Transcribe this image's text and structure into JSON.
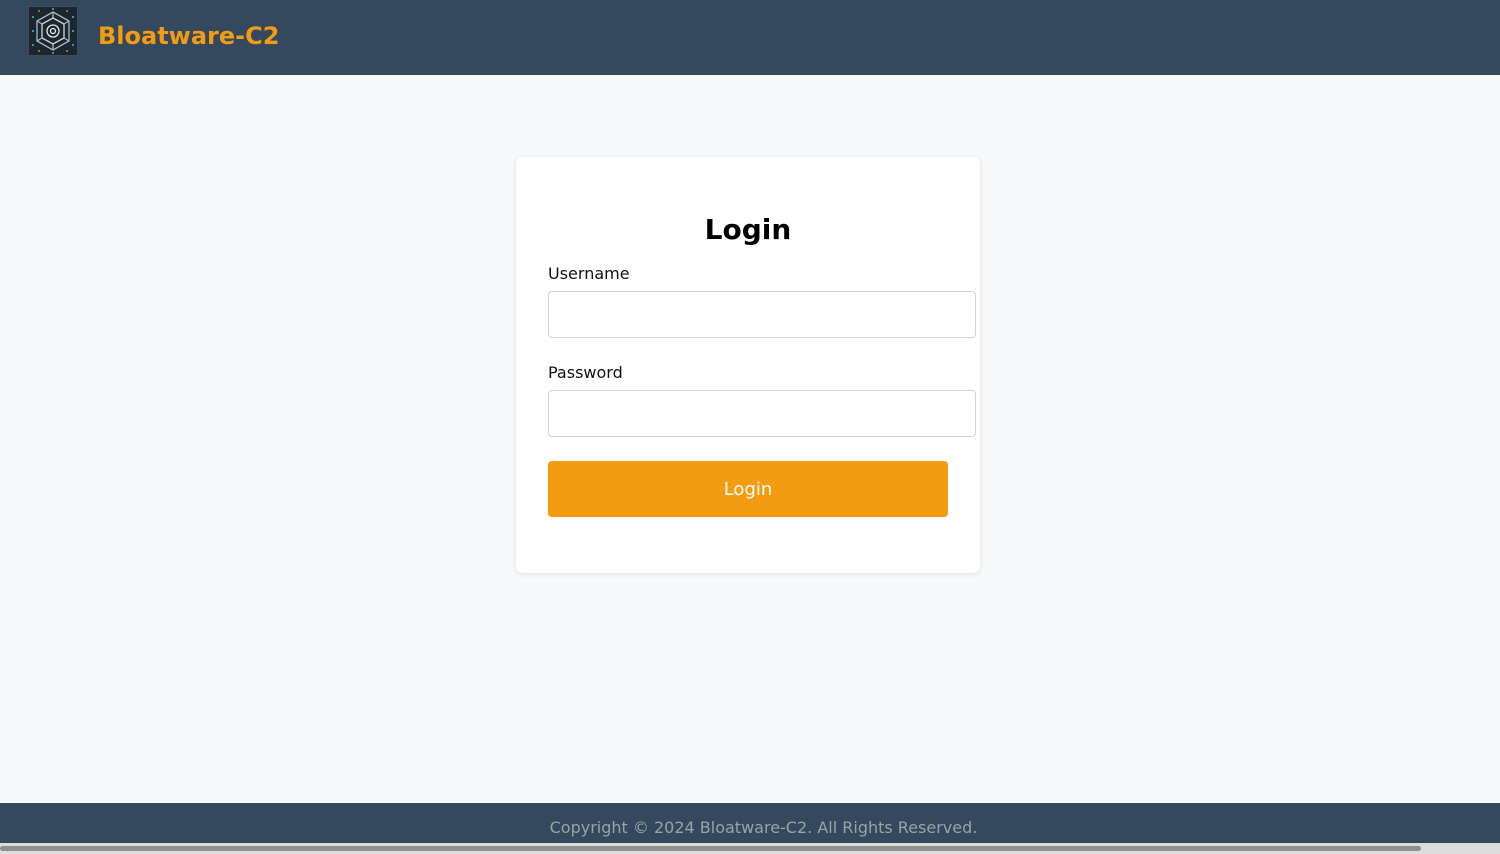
{
  "header": {
    "brand": "Bloatware-C2",
    "logo_icon": "hexagon-network-logo-icon"
  },
  "login": {
    "title": "Login",
    "username_label": "Username",
    "username_value": "",
    "password_label": "Password",
    "password_value": "",
    "submit_label": "Login"
  },
  "footer": {
    "copyright": "Copyright © 2024 Bloatware-C2. All Rights Reserved."
  },
  "colors": {
    "header_bg": "#34495e",
    "accent": "#f39c12",
    "page_bg": "#f7f9fa",
    "footer_text": "#95a5a6"
  }
}
